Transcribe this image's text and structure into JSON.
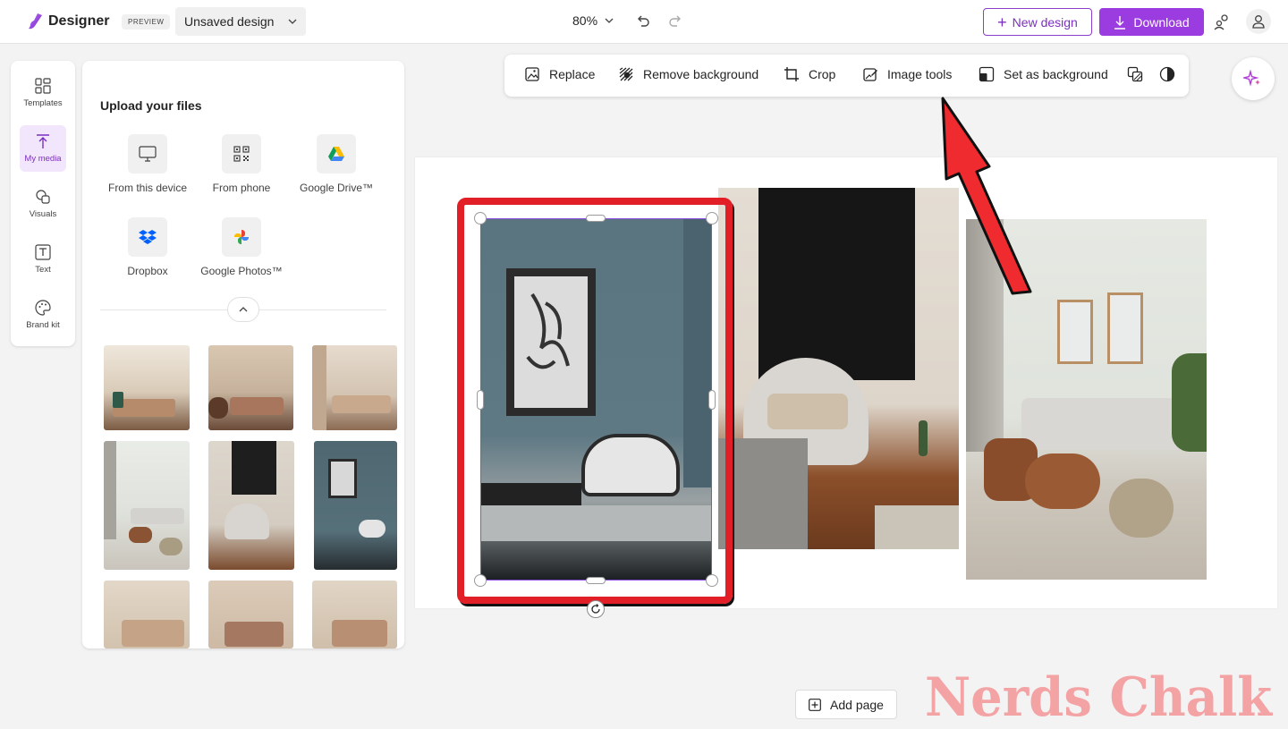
{
  "app": {
    "name": "Designer",
    "badge": "PREVIEW",
    "design_name": "Unsaved design",
    "zoom": "80%"
  },
  "header": {
    "new_design_label": "New design",
    "download_label": "Download"
  },
  "rail": {
    "items": [
      {
        "label": "Templates",
        "icon": "templates-icon",
        "active": false
      },
      {
        "label": "My media",
        "icon": "upload-icon",
        "active": true
      },
      {
        "label": "Visuals",
        "icon": "visuals-icon",
        "active": false
      },
      {
        "label": "Text",
        "icon": "text-icon",
        "active": false
      },
      {
        "label": "Brand kit",
        "icon": "palette-icon",
        "active": false
      }
    ]
  },
  "media_panel": {
    "title": "Upload your files",
    "sources": [
      {
        "label": "From this device",
        "icon": "monitor-icon"
      },
      {
        "label": "From phone",
        "icon": "qr-code-icon"
      },
      {
        "label": "Google Drive™",
        "icon": "google-drive-icon"
      },
      {
        "label": "Dropbox",
        "icon": "dropbox-icon"
      },
      {
        "label": "Google Photos™",
        "icon": "google-photos-icon"
      }
    ]
  },
  "context_toolbar": {
    "items": [
      {
        "label": "Replace",
        "icon": "replace-image-icon"
      },
      {
        "label": "Remove background",
        "icon": "remove-background-icon"
      },
      {
        "label": "Crop",
        "icon": "crop-icon"
      },
      {
        "label": "Image tools",
        "icon": "image-tools-icon"
      },
      {
        "label": "Set as background",
        "icon": "set-background-icon"
      }
    ],
    "extra_icons": [
      "layers-icon",
      "filter-icon"
    ]
  },
  "footer": {
    "add_page_label": "Add page"
  },
  "watermark": {
    "text": "Nerds Chalk"
  },
  "colors": {
    "accent": "#9b3ce0",
    "annotation": "#e21f26",
    "selection": "#8a4fe0"
  }
}
